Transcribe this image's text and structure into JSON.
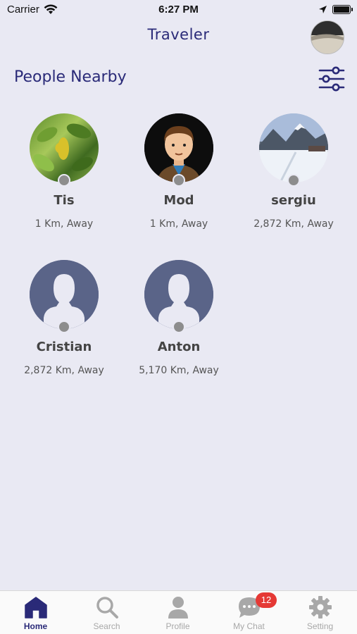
{
  "status_bar": {
    "carrier": "Carrier",
    "time": "6:27 PM"
  },
  "header": {
    "title": "Traveler",
    "avatar_icon": "user-avatar-photo"
  },
  "section": {
    "title": "People Nearby",
    "filter_icon": "sliders-icon"
  },
  "people": [
    {
      "name": "Tis",
      "distance": "1 Km, Away",
      "photo": "leaves-photo",
      "online": false
    },
    {
      "name": "Mod",
      "distance": "1 Km, Away",
      "photo": "man-illustration",
      "online": false
    },
    {
      "name": "sergiu",
      "distance": "2,872 Km, Away",
      "photo": "snowy-mountain-photo",
      "online": false
    },
    {
      "name": "Cristian",
      "distance": "2,872 Km, Away",
      "photo": "default-avatar",
      "online": false
    },
    {
      "name": "Anton",
      "distance": "5,170 Km, Away",
      "photo": "default-avatar",
      "online": false
    }
  ],
  "tabs": [
    {
      "label": "Home",
      "icon": "home-icon",
      "active": true
    },
    {
      "label": "Search",
      "icon": "search-icon",
      "active": false
    },
    {
      "label": "Profile",
      "icon": "profile-icon",
      "active": false
    },
    {
      "label": "My Chat",
      "icon": "chat-icon",
      "active": false,
      "badge": "12"
    },
    {
      "label": "Setting",
      "icon": "gear-icon",
      "active": false
    }
  ],
  "colors": {
    "background": "#e9e9f3",
    "accent": "#2a2a78",
    "placeholder_avatar": "#5a6488",
    "offline_dot": "#8d8d8d",
    "badge": "#e53935",
    "inactive_tab": "#a8a8a8"
  }
}
